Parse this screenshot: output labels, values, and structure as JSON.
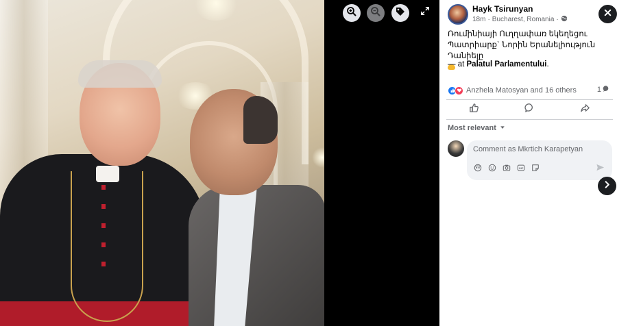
{
  "post": {
    "author": "Hayk Tsirunyan",
    "time": "18m",
    "location_meta": "Bucharest, Romania",
    "caption": "Ռումինիայի Ուղղափառ եկեղեցու Պատրիարք` Նորին Երանելիություն Դանիելը",
    "at_prefix": "— at",
    "place": "Palatul Parlamentului",
    "place_suffix": "."
  },
  "reactions": {
    "text": "Anzhela Matosyan and 16 others",
    "comment_count": "1",
    "colors": {
      "like": "#1877f2",
      "love": "#f33e58"
    }
  },
  "actions": {
    "icons": [
      "like-icon",
      "comment-icon",
      "share-icon"
    ]
  },
  "comments": {
    "sort_label": "Most relevant",
    "input_placeholder": "Comment as Mkrtich Karapetyan",
    "tools": [
      "avatar-sticker-icon",
      "emoji-icon",
      "camera-icon",
      "gif-icon",
      "sticker-icon"
    ]
  },
  "viewer": {
    "buttons": [
      "zoom-in-icon",
      "zoom-out-icon",
      "tag-icon",
      "fullscreen-icon"
    ]
  },
  "colors": {
    "panel_bg": "#ffffff",
    "viewer_bg": "#000000",
    "muted_text": "#65676b",
    "primary_text": "#050505",
    "input_bg": "#f0f2f5"
  }
}
